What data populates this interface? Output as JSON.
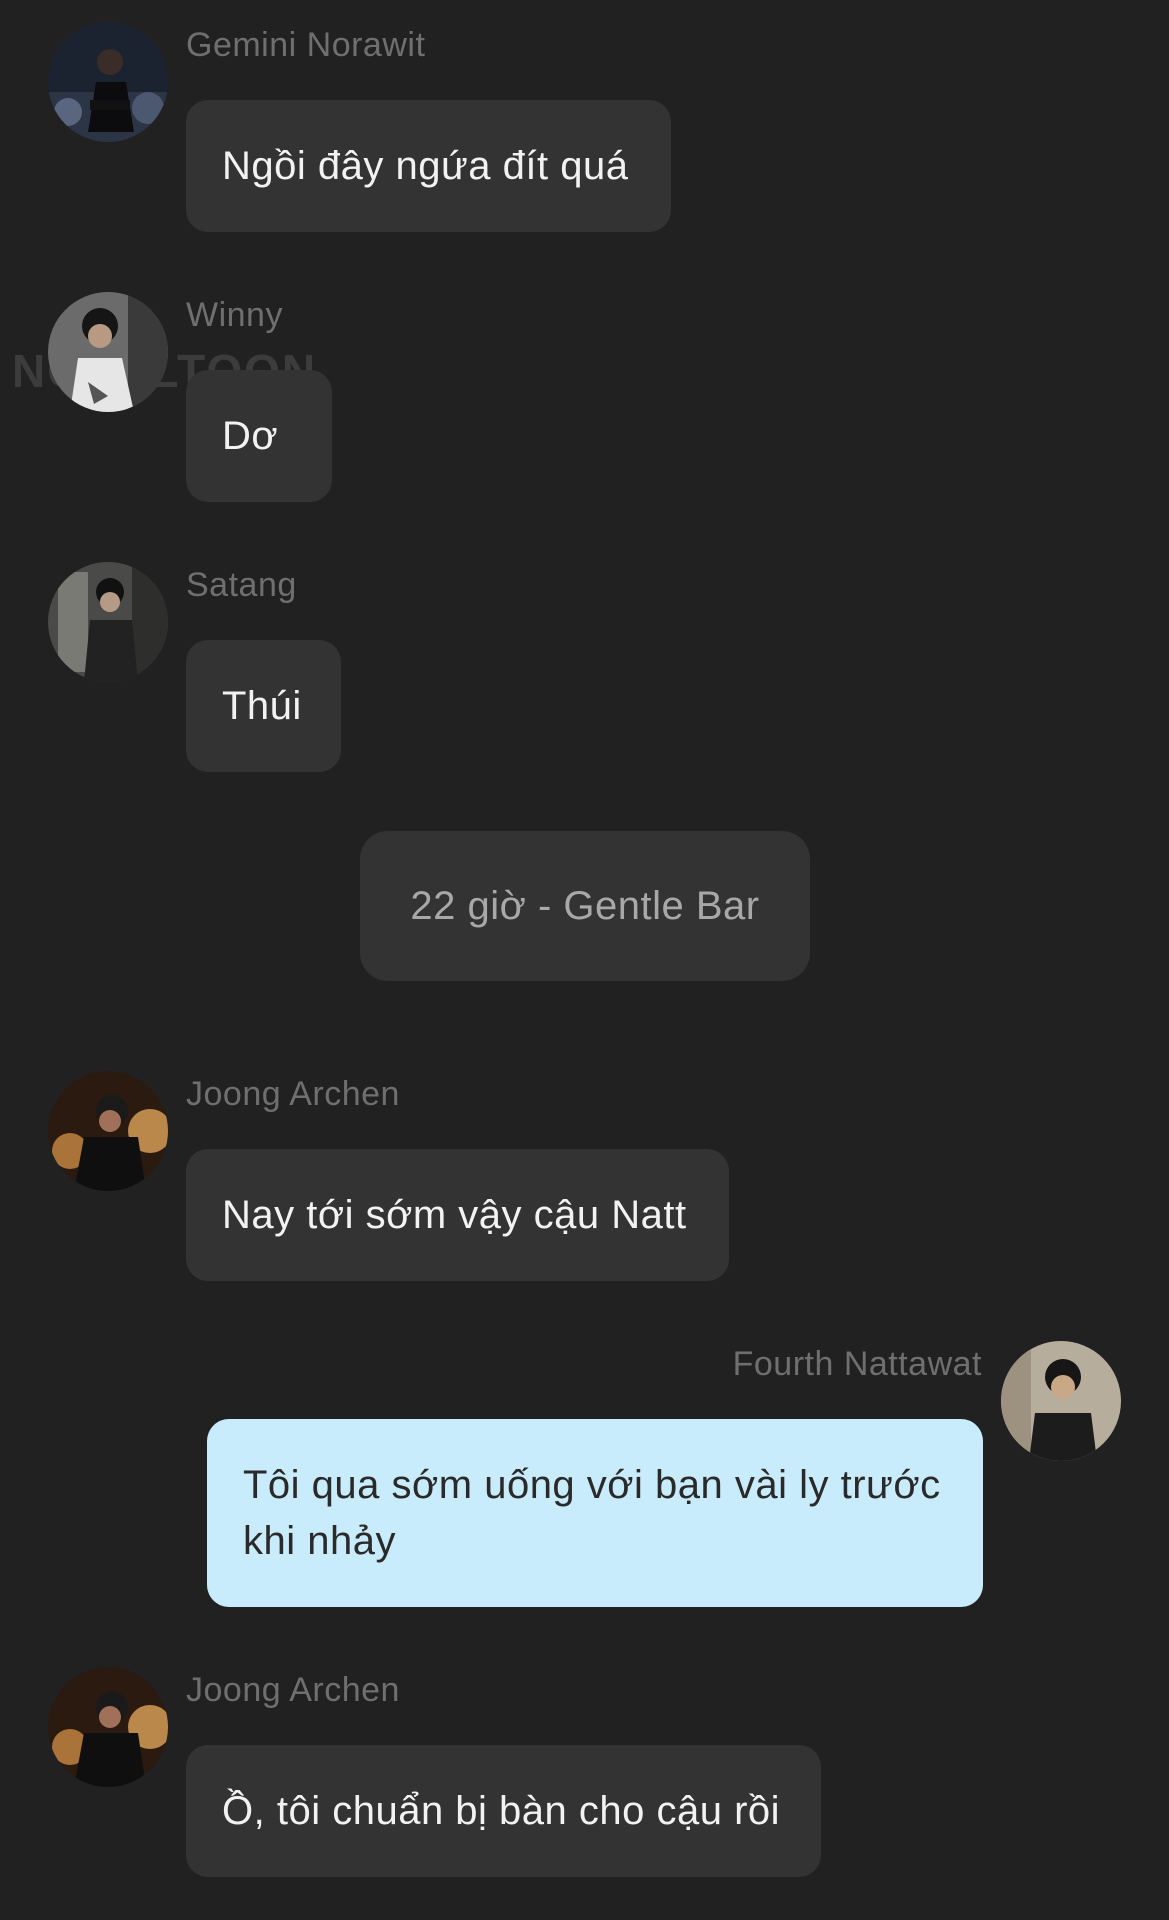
{
  "watermark": "NOVELTOON",
  "messages": [
    {
      "sender": "Gemini Norawit",
      "text": "Ngồi đây ngứa đít quá",
      "avatar": "avatar-gemini"
    },
    {
      "sender": "Winny",
      "text": "Dơ",
      "avatar": "avatar-winny"
    },
    {
      "sender": "Satang",
      "text": "Thúi",
      "avatar": "avatar-satang"
    },
    {
      "sender": "Joong Archen",
      "text": "Nay tới sớm vậy cậu Natt",
      "avatar": "avatar-joong"
    },
    {
      "sender": "Fourth Nattawat",
      "text": "Tôi qua sớm uống với bạn vài ly trước khi nhảy",
      "avatar": "avatar-fourth",
      "outgoing": true
    },
    {
      "sender": "Joong Archen",
      "text": "Ồ, tôi chuẩn bị bàn cho cậu rồi",
      "avatar": "avatar-joong"
    }
  ],
  "divider": {
    "text": "22 giờ - Gentle Bar"
  },
  "colors": {
    "background": "#212121",
    "bubble_incoming": "#333333",
    "bubble_outgoing": "#c8ecfb",
    "sender_name": "#6f6f6f"
  }
}
